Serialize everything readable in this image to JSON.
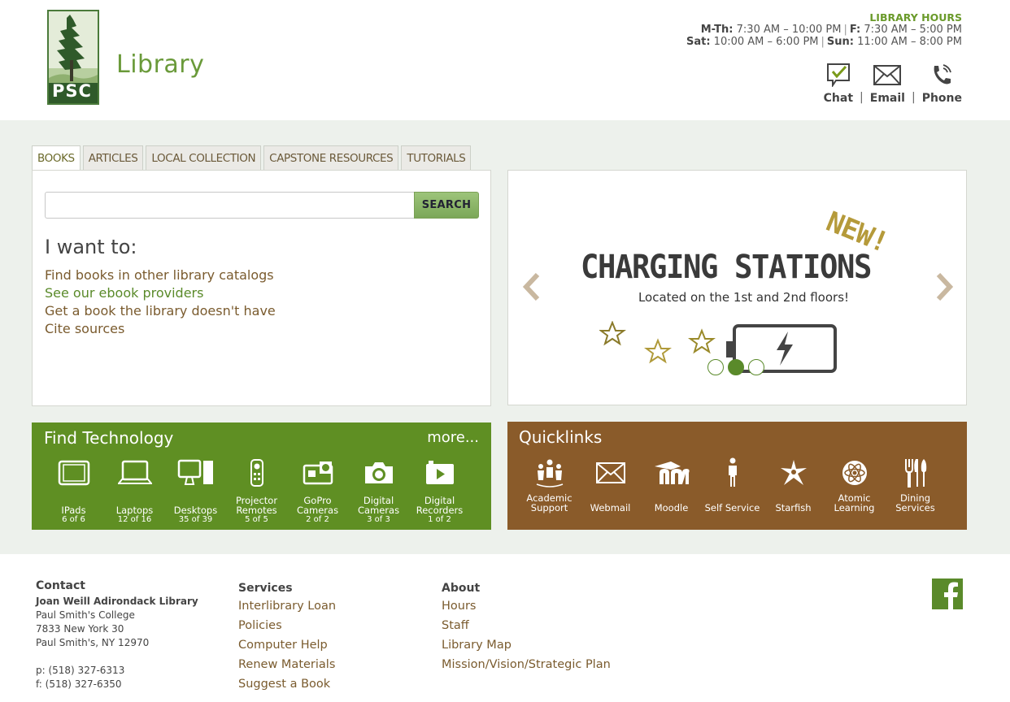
{
  "header": {
    "logo_text": "Library",
    "logo_mark": "PSC",
    "hours_title": "LIBRARY HOURS",
    "hours_row1": [
      {
        "day": "M-Th:",
        "time": "7:30 AM – 10:00 PM"
      },
      {
        "day": "F:",
        "time": "7:30 AM – 5:00 PM"
      }
    ],
    "hours_row2": [
      {
        "day": "Sat:",
        "time": "10:00 AM – 6:00 PM"
      },
      {
        "day": "Sun:",
        "time": "11:00 AM – 8:00 PM"
      }
    ],
    "contact_links": {
      "chat": "Chat",
      "email": "Email",
      "phone": "Phone",
      "separator": "|"
    }
  },
  "search": {
    "tabs": [
      "BOOKS",
      "ARTICLES",
      "LOCAL COLLECTION",
      "CAPSTONE RESOURCES",
      "TUTORIALS"
    ],
    "active_tab": "BOOKS",
    "input_value": "",
    "button_label": "SEARCH",
    "heading": "I want to:",
    "links": [
      "Find books in other library catalogs",
      "See our ebook providers",
      "Get a book the library doesn't have",
      "Cite sources"
    ]
  },
  "carousel": {
    "title": "CHARGING STATIONS",
    "badge": "NEW!",
    "subtitle": "Located on the 1st and 2nd floors!",
    "active_slide": 2,
    "slide_count": 3
  },
  "tech": {
    "title": "Find Technology",
    "more": "more...",
    "items": [
      {
        "label": "IPads",
        "count": "6 of 6",
        "icon": "tablet-icon"
      },
      {
        "label": "Laptops",
        "count": "12 of 16",
        "icon": "laptop-icon"
      },
      {
        "label": "Desktops",
        "count": "35 of 39",
        "icon": "desktop-icon"
      },
      {
        "label": "Projector Remotes",
        "count": "5 of 5",
        "icon": "remote-icon"
      },
      {
        "label": "GoPro Cameras",
        "count": "2 of 2",
        "icon": "gopro-icon"
      },
      {
        "label": "Digital Cameras",
        "count": "3 of 3",
        "icon": "camera-icon"
      },
      {
        "label": "Digital Recorders",
        "count": "1 of 2",
        "icon": "recorder-icon"
      }
    ]
  },
  "quicklinks": {
    "title": "Quicklinks",
    "items": [
      {
        "label": "Academic Support",
        "icon": "people-icon"
      },
      {
        "label": "Webmail",
        "icon": "envelope-icon"
      },
      {
        "label": "Moodle",
        "icon": "moodle-icon"
      },
      {
        "label": "Self Service",
        "icon": "person-icon"
      },
      {
        "label": "Starfish",
        "icon": "starfish-icon"
      },
      {
        "label": "Atomic Learning",
        "icon": "atom-icon"
      },
      {
        "label": "Dining Services",
        "icon": "utensils-icon"
      }
    ]
  },
  "footer": {
    "contact": {
      "heading": "Contact",
      "org": "Joan Weill Adirondack Library",
      "lines": [
        "Paul Smith's College",
        "7833 New York 30",
        "Paul Smith's, NY 12970"
      ],
      "phone": "p: (518) 327-6313",
      "fax": "f: (518) 327-6350"
    },
    "services": {
      "heading": "Services",
      "links": [
        "Interlibrary Loan",
        "Policies",
        "Computer Help",
        "Renew Materials",
        "Suggest a Book"
      ]
    },
    "about": {
      "heading": "About",
      "links": [
        "Hours",
        "Staff",
        "Library Map",
        "Mission/Vision/Strategic Plan"
      ]
    },
    "social_icon": "facebook-icon"
  },
  "colors": {
    "green": "#5f8f23",
    "brown": "#8a5b2a",
    "link_brown": "#7a5b2e",
    "link_green": "#5a8a2a",
    "band": "#edf1ec"
  }
}
